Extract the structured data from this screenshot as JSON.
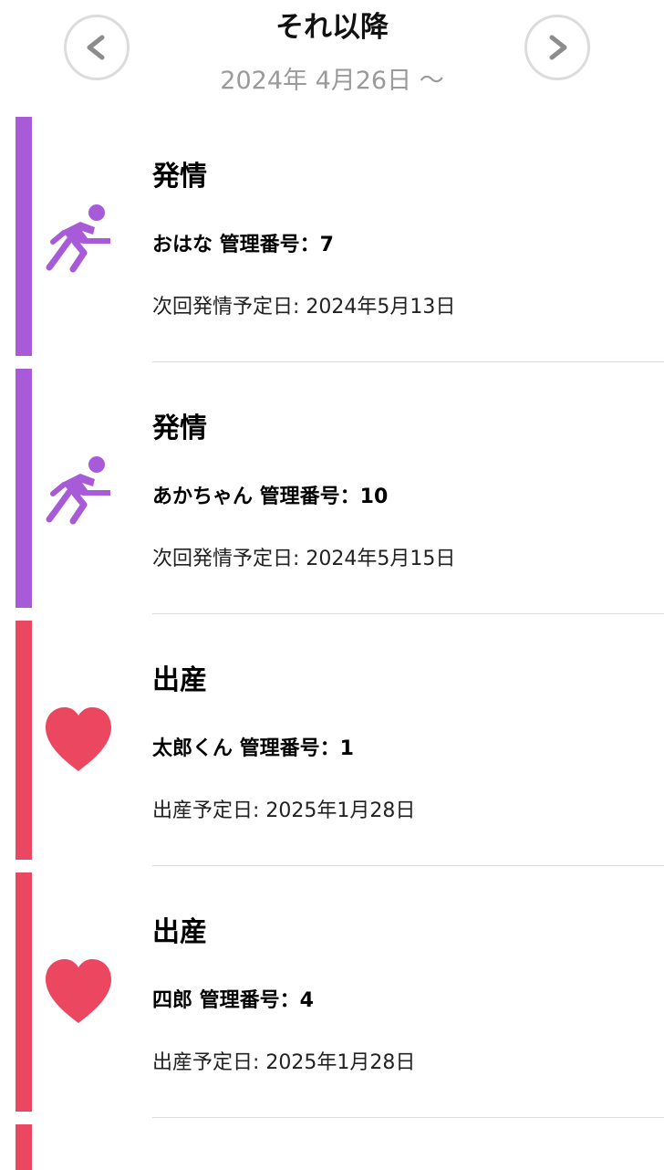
{
  "header": {
    "title": "それ以降",
    "date_range": "2024年 4月26日 〜",
    "prev_icon": "chevron-left-icon",
    "next_icon": "chevron-right-icon"
  },
  "colors": {
    "estrus": "#A85BD9",
    "birth": "#EC4761"
  },
  "events": [
    {
      "type": "estrus",
      "icon": "person-pushing-icon",
      "title": "発情",
      "name": "おはな 管理番号：7",
      "date": "次回発情予定日: 2024年5月13日"
    },
    {
      "type": "estrus",
      "icon": "person-pushing-icon",
      "title": "発情",
      "name": "あかちゃん 管理番号：10",
      "date": "次回発情予定日: 2024年5月15日"
    },
    {
      "type": "birth",
      "icon": "heart-icon",
      "title": "出産",
      "name": "太郎くん 管理番号：1",
      "date": "出産予定日: 2025年1月28日"
    },
    {
      "type": "birth",
      "icon": "heart-icon",
      "title": "出産",
      "name": "四郎 管理番号：4",
      "date": "出産予定日: 2025年1月28日"
    }
  ]
}
